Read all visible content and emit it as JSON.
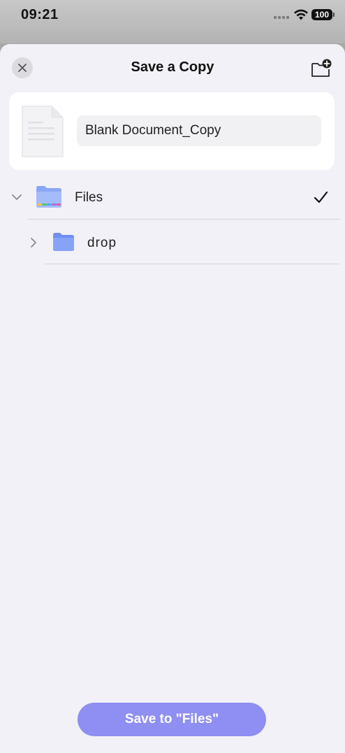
{
  "status_bar": {
    "time": "09:21",
    "battery": "100"
  },
  "header": {
    "title": "Save a Copy",
    "close_icon": "close-icon",
    "new_folder_icon": "folder-add-icon"
  },
  "file": {
    "name": "Blank Document_Copy"
  },
  "tree": {
    "items": [
      {
        "label": "Files",
        "expanded": true,
        "selected": true,
        "icon": "files-app-folder-icon"
      },
      {
        "label": "drop",
        "expanded": false,
        "selected": false,
        "icon": "folder-icon"
      }
    ]
  },
  "footer": {
    "save_label": "Save to \"Files\""
  },
  "colors": {
    "accent": "#8f8ef2",
    "folder_blue": "#7d9cf5",
    "sheet_bg": "#f2f1f7"
  }
}
